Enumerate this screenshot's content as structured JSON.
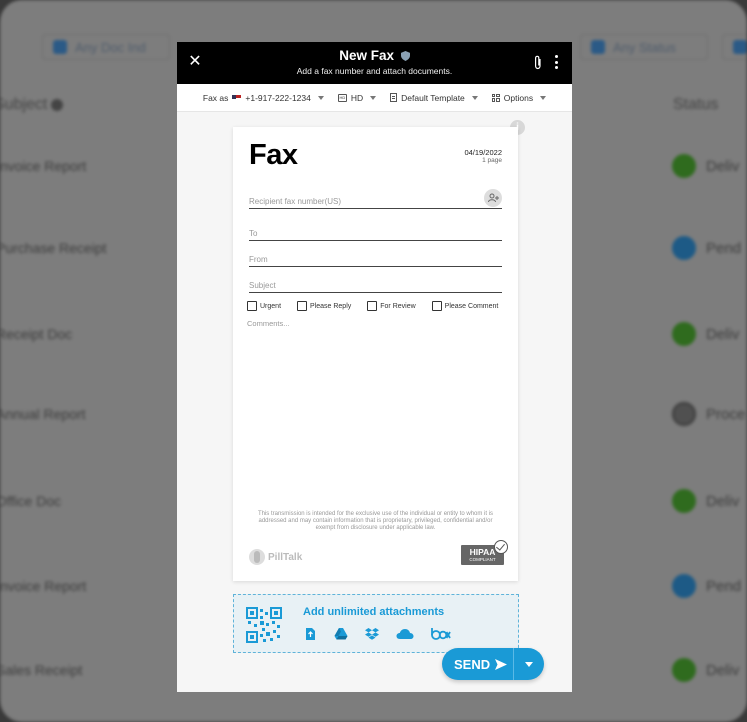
{
  "background": {
    "filters": [
      "Any Doc Ind",
      "Any Status"
    ],
    "columns": {
      "subject": "Subject",
      "status": "Status"
    },
    "rows": [
      {
        "subject": "Invoice Report",
        "status": "Deliv",
        "color": "green"
      },
      {
        "subject": "Purchase Receipt",
        "status": "Pend",
        "color": "blue"
      },
      {
        "subject": "Receipt Doc",
        "status": "Deliv",
        "color": "green"
      },
      {
        "subject": "Annual Report",
        "status": "Proce",
        "color": "grey"
      },
      {
        "subject": "Office Doc",
        "status": "Deliv",
        "color": "green"
      },
      {
        "subject": "Invoice Report",
        "status": "Pend",
        "color": "blue"
      },
      {
        "subject": "Sales Receipt",
        "status": "Deliv",
        "color": "green"
      }
    ]
  },
  "modal": {
    "title": "New Fax",
    "subtitle": "Add a fax number and attach documents.",
    "toolbar": {
      "fax_as_label": "Fax as",
      "fax_as_number": "+1-917-222-1234",
      "quality": "HD",
      "template": "Default Template",
      "options": "Options"
    },
    "sheet": {
      "title": "Fax",
      "date": "04/19/2022",
      "pages": "1 page",
      "recipient_placeholder": "Recipient fax number(US)",
      "to_placeholder": "To",
      "from_placeholder": "From",
      "subject_placeholder": "Subject",
      "checks": [
        "Urgent",
        "Please Reply",
        "For Review",
        "Please Comment"
      ],
      "comments_placeholder": "Comments...",
      "disclaimer": "This transmission is intended for the exclusive use of the individual or entity to whom it is addressed and may contain information that is proprietary, privileged, confidential and/or exempt from disclosure under applicable law.",
      "brand": "PillTalk",
      "hipaa_title": "HIPAA",
      "hipaa_sub": "COMPLIANT"
    },
    "attachments": {
      "label": "Add unlimited attachments",
      "sources": [
        "upload-icon",
        "google-drive-icon",
        "dropbox-icon",
        "onedrive-icon",
        "box-icon"
      ]
    },
    "send": {
      "label": "SEND"
    }
  },
  "colors": {
    "accent": "#1a9ad6",
    "header_bg": "#000000"
  }
}
